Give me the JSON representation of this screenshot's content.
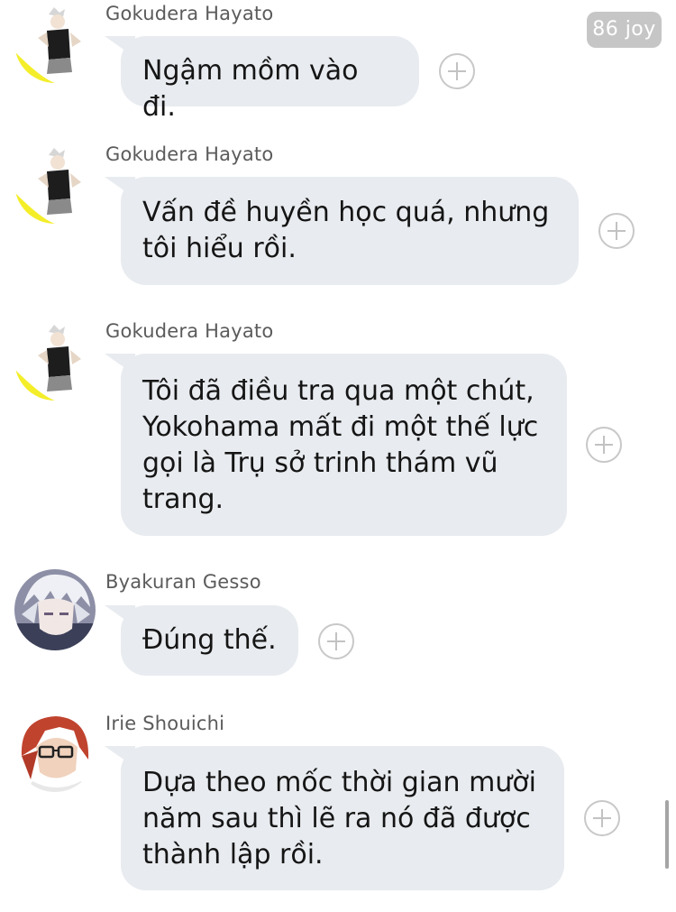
{
  "badge": {
    "label": "86 joy"
  },
  "messages": [
    {
      "sender": "Gokudera Hayato",
      "avatar_icon": "gokudera-avatar",
      "text": "Ngậm mồm vào đi."
    },
    {
      "sender": "Gokudera Hayato",
      "avatar_icon": "gokudera-avatar",
      "text": "Vấn đề huyền học quá, nhưng\ntôi hiểu rồi."
    },
    {
      "sender": "Gokudera Hayato",
      "avatar_icon": "gokudera-avatar",
      "text": "Tôi đã điều tra qua một chút,\nYokohama mất đi một thế lực\ngọi là Trụ sở trinh thám vũ\ntrang."
    },
    {
      "sender": "Byakuran Gesso",
      "avatar_icon": "byakuran-avatar",
      "text": "Đúng thế."
    },
    {
      "sender": "Irie Shouichi",
      "avatar_icon": "irie-avatar",
      "text": "Dựa theo mốc thời gian mười\nnăm sau thì lẽ ra nó đã được\nthành lập rồi."
    }
  ],
  "colors": {
    "bubble": "#e8ebef",
    "sender": "#5b5b5b",
    "badge": "#c6c6c6"
  }
}
